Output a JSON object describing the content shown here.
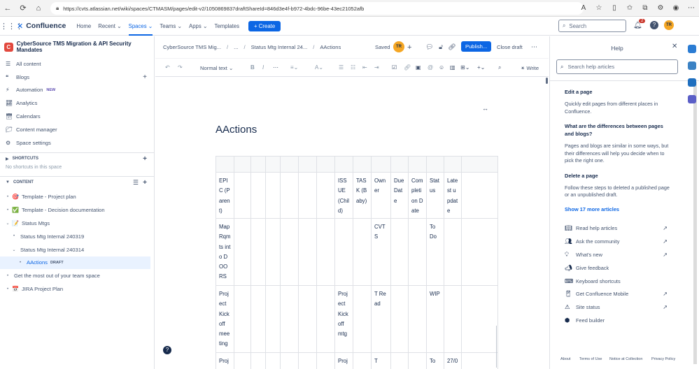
{
  "browser": {
    "url": "https://cvts.atlassian.net/wiki/spaces/CTMASM/pages/edit-v2/1050869837draftShareId=846d3e4f-b972-4bdc-96be-43ec21052afb"
  },
  "topnav": {
    "product": "Confluence",
    "items": [
      "Home",
      "Recent",
      "Spaces",
      "Teams",
      "Apps",
      "Templates"
    ],
    "create_label": "Create",
    "search_placeholder": "Search",
    "notification_count": "2",
    "avatar_initials": "TR"
  },
  "sidebar": {
    "space_name": "CyberSource TMS Migration & API Security Mandates",
    "space_initial": "C",
    "items": [
      {
        "label": "All content",
        "icon": "list-icon"
      },
      {
        "label": "Blogs",
        "icon": "quote-icon"
      },
      {
        "label": "Automation",
        "icon": "bolt-icon",
        "badge": "NEW"
      },
      {
        "label": "Analytics",
        "icon": "chart-icon"
      },
      {
        "label": "Calendars",
        "icon": "calendar-icon"
      },
      {
        "label": "Content manager",
        "icon": "folder-icon"
      },
      {
        "label": "Space settings",
        "icon": "gear-icon"
      }
    ],
    "shortcuts_heading": "SHORTCUTS",
    "shortcuts_empty": "No shortcuts in this space",
    "content_heading": "CONTENT",
    "tree": [
      {
        "label": "Template - Project plan",
        "level": 0,
        "toggle": "•",
        "emoji": "🎯"
      },
      {
        "label": "Template - Decision documentation",
        "level": 0,
        "toggle": "•",
        "emoji": "✅"
      },
      {
        "label": "Status Mtgs",
        "level": 0,
        "toggle": "⌄",
        "emoji": "📝"
      },
      {
        "label": "Status Mtg Internal 240319",
        "level": 1,
        "toggle": "•",
        "emoji": ""
      },
      {
        "label": "Status Mtg Internal 240314",
        "level": 1,
        "toggle": "⌄",
        "emoji": ""
      },
      {
        "label": "AActions",
        "level": 2,
        "toggle": "•",
        "emoji": "",
        "draft": "DRAFT",
        "selected": true
      },
      {
        "label": "Get the most out of your team space",
        "level": 0,
        "toggle": "•",
        "emoji": ""
      },
      {
        "label": "JIRA Project Plan",
        "level": 0,
        "toggle": "•",
        "emoji": "📅"
      }
    ]
  },
  "editor_header": {
    "crumbs": [
      "CyberSource TMS Mig...",
      "...",
      "Status Mtg Internal 24...",
      "AActions"
    ],
    "saved": "Saved",
    "avatar_initials": "TR",
    "publish": "Publish...",
    "close_draft": "Close draft"
  },
  "toolbar": {
    "text_style": "Normal text",
    "write": "Write"
  },
  "page": {
    "title": "AActions",
    "table": {
      "col_widths": [
        26,
        24,
        21,
        21,
        26,
        26,
        26,
        26,
        26,
        28,
        25,
        26,
        25,
        25,
        52
      ],
      "rows": [
        {
          "cells": [
            "EPIC (Parent)",
            "",
            "",
            "",
            "",
            "",
            "",
            "ISSUE (Child)",
            "TASK (Baby)",
            "Owner",
            "Due Date",
            "Completion Date",
            "Status",
            "Latest update",
            ""
          ],
          "height": 66
        },
        {
          "cells": [
            "Map Rqmts into DOORS",
            "",
            "",
            "",
            "",
            "",
            "",
            "",
            "",
            "CVTS",
            "",
            "",
            "To Do",
            "",
            ""
          ],
          "height": 96
        },
        {
          "cells": [
            "Project Kick off meeting",
            "",
            "",
            "",
            "",
            "",
            "",
            "Project Kick off mtg",
            "",
            "T Read",
            "",
            "",
            "WIP",
            "",
            ""
          ],
          "height": 96
        },
        {
          "cells": [
            "Proj",
            "",
            "",
            "",
            "",
            "",
            "",
            "Proj",
            "",
            "T",
            "",
            "",
            "To",
            "27/0",
            ""
          ],
          "height": 40
        }
      ]
    }
  },
  "help": {
    "title": "Help",
    "search_placeholder": "Search help articles",
    "articles": [
      {
        "q": "Edit a page",
        "a": "Quickly edit pages from different places in Confluence."
      },
      {
        "q": "What are the differences between pages and blogs?",
        "a": "Pages and blogs are similar in some ways, but their differences will help you decide when to pick the right one."
      },
      {
        "q": "Delete a page",
        "a": "Follow these steps to deleted a published page or an unpublished draft."
      }
    ],
    "show_more": "Show 17 more articles",
    "links": [
      {
        "label": "Read help articles",
        "icon": "book-icon",
        "external": true
      },
      {
        "label": "Ask the community",
        "icon": "community-icon",
        "external": true
      },
      {
        "label": "What's new",
        "icon": "lightbulb-icon",
        "external": true
      },
      {
        "label": "Give feedback",
        "icon": "megaphone-icon",
        "external": false
      },
      {
        "label": "Keyboard shortcuts",
        "icon": "keyboard-icon",
        "external": false
      },
      {
        "label": "Get Confluence Mobile",
        "icon": "mobile-icon",
        "external": true
      },
      {
        "label": "Site status",
        "icon": "warning-icon",
        "external": true
      },
      {
        "label": "Feed builder",
        "icon": "feed-icon",
        "external": false
      }
    ],
    "footer": [
      "About",
      "Terms of Use",
      "Notice at Collection",
      "Privacy Policy"
    ]
  },
  "colors": {
    "accent": "#0c66e4",
    "avatar": "#f5a623",
    "space_logo": "#e2483d"
  }
}
